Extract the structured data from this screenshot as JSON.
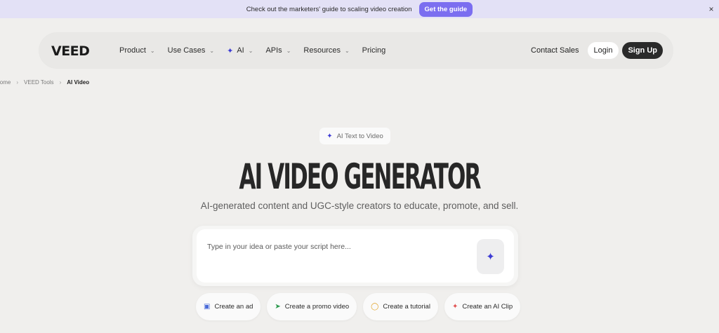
{
  "announcement": {
    "message": "Check out the marketers' guide to scaling video creation",
    "cta_label": "Get the guide",
    "close_glyph": "×"
  },
  "nav": {
    "logo": "VEED",
    "menu": [
      {
        "label": "Product",
        "has_chevron": true
      },
      {
        "label": "Use Cases",
        "has_chevron": true
      },
      {
        "label": "AI",
        "has_chevron": true,
        "icon": "sparkle-icon"
      },
      {
        "label": "APIs",
        "has_chevron": true
      },
      {
        "label": "Resources",
        "has_chevron": true
      },
      {
        "label": "Pricing",
        "has_chevron": false
      }
    ],
    "contact_sales": "Contact Sales",
    "login": "Login",
    "signup": "Sign Up"
  },
  "breadcrumb": [
    "Home",
    "VEED Tools",
    "AI Video"
  ],
  "hero": {
    "badge": "AI Text to Video",
    "title": "AI VIDEO GENERATOR",
    "subtitle": "AI-generated content and UGC-style creators to educate, promote, and sell.",
    "prompt_placeholder": "Type in your idea or paste your script here..."
  },
  "chips": [
    {
      "label": "Create an ad",
      "icon": "ad-icon"
    },
    {
      "label": "Create a promo video",
      "icon": "megaphone-icon"
    },
    {
      "label": "Create a tutorial",
      "icon": "lightbulb-icon"
    },
    {
      "label": "Create an AI Clip",
      "icon": "magic-wand-icon"
    }
  ],
  "colors": {
    "accent": "#7b6ef0",
    "sparkle": "#3d3bd4",
    "announcement_bg": "#e3e1f6",
    "page_bg": "#f0efed"
  }
}
